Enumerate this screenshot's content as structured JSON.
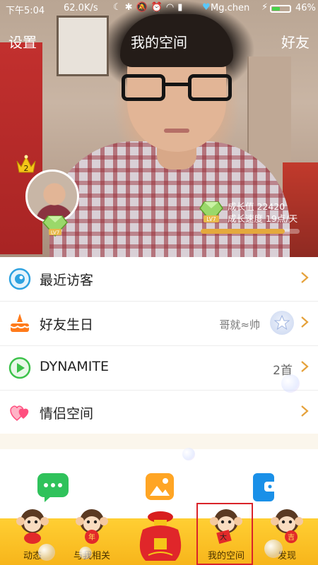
{
  "status_bar": {
    "time": "下午5:04",
    "network_speed": "62.0K/s",
    "user_name": "Mg.chen",
    "battery_percent_label": "46%",
    "battery_level": 0.46
  },
  "navbar": {
    "left_label": "设置",
    "title": "我的空间",
    "right_label": "好友"
  },
  "profile": {
    "avatar_level": "LV7",
    "crown_badge": "2",
    "growth_level": "LV7",
    "growth_value_text": "成长值 22420",
    "growth_speed_text": "成长速度 19点/天",
    "growth_progress": 0.85
  },
  "menu": [
    {
      "label": "最近访客",
      "icon": "eye-icon"
    },
    {
      "label": "好友生日",
      "value": "哥就≈帅",
      "icon": "cake-icon"
    },
    {
      "label": "DYNAMITE",
      "value": "2首",
      "icon": "play-icon"
    },
    {
      "label": "情侣空间",
      "icon": "hearts-icon"
    }
  ],
  "quick_icons": [
    "chat-bubble-icon",
    "photo-album-icon",
    "wallet-icon"
  ],
  "tabs": [
    {
      "label": "动态",
      "icon": "monkey-icon"
    },
    {
      "label": "与我相关",
      "icon": "monkey-year-icon",
      "badge": "年"
    },
    {
      "label": "我的空间",
      "icon": "monkey-big-icon",
      "badge": "大",
      "selected": true
    },
    {
      "label": "发现",
      "icon": "monkey-luck-icon",
      "badge": "吉"
    }
  ],
  "center_bag_icon": "lucky-bag-icon",
  "colors": {
    "tabbar": "#ffc629",
    "selected_box": "#d9232a",
    "chevron": "#e5a13a",
    "menu_text": "#222222"
  }
}
